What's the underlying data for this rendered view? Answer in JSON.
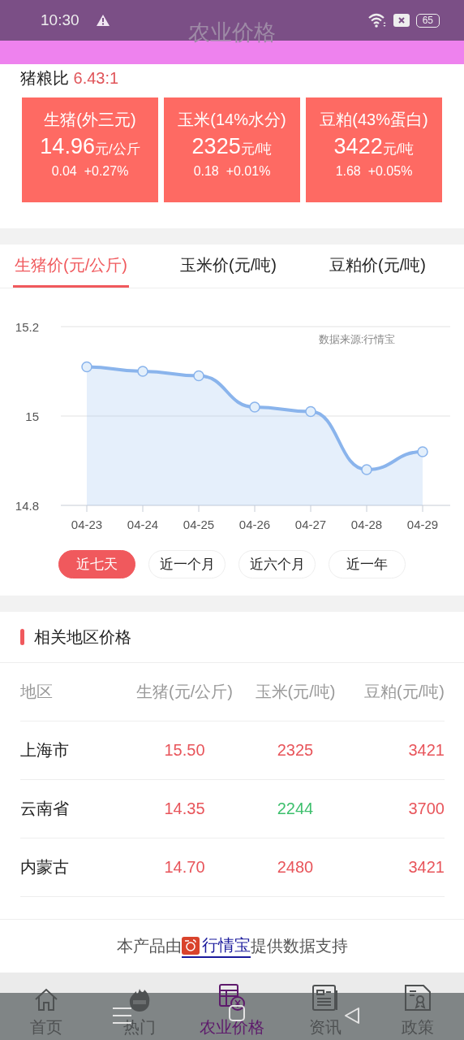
{
  "status_bar": {
    "time": "10:30",
    "battery": "65"
  },
  "header": {
    "title": "农业价格"
  },
  "ratio": {
    "label": "猪粮比",
    "value": "6.43:1"
  },
  "cards": [
    {
      "title": "生猪(外三元)",
      "price": "14.96",
      "unit": "元/公斤",
      "change": "0.04",
      "percent": "+0.27%"
    },
    {
      "title": "玉米(14%水分)",
      "price": "2325",
      "unit": "元/吨",
      "change": "0.18",
      "percent": "+0.01%"
    },
    {
      "title": "豆粕(43%蛋白)",
      "price": "3422",
      "unit": "元/吨",
      "change": "1.68",
      "percent": "+0.05%"
    }
  ],
  "tabs": [
    {
      "label": "生猪价(元/公斤)",
      "selected": true
    },
    {
      "label": "玉米价(元/吨)",
      "selected": false
    },
    {
      "label": "豆粕价(元/吨)",
      "selected": false
    }
  ],
  "chart_data": {
    "type": "area",
    "categories": [
      "04-23",
      "04-24",
      "04-25",
      "04-26",
      "04-27",
      "04-28",
      "04-29"
    ],
    "series": [
      {
        "color": "#8ab4ec",
        "values": [
          15.11,
          15.1,
          15.09,
          15.02,
          15.01,
          14.88,
          14.92
        ]
      }
    ],
    "ylim": [
      14.8,
      15.2
    ],
    "yticks": [
      14.8,
      15,
      15.2
    ],
    "annotations": [
      {
        "text": "数据来源:行情宝"
      }
    ]
  },
  "ranges": [
    {
      "label": "近七天",
      "selected": true
    },
    {
      "label": "近一个月",
      "selected": false
    },
    {
      "label": "近六个月",
      "selected": false
    },
    {
      "label": "近一年",
      "selected": false
    }
  ],
  "region_table": {
    "title": "相关地区价格",
    "columns": [
      "地区",
      "生猪(元/公斤)",
      "玉米(元/吨)",
      "豆粕(元/吨)"
    ],
    "rows": [
      {
        "cells": [
          {
            "value": "上海市",
            "color": "#222222"
          },
          {
            "value": "15.50",
            "color": "#e8555b"
          },
          {
            "value": "2325",
            "color": "#e8555b"
          },
          {
            "value": "3421",
            "color": "#e8555b"
          }
        ]
      },
      {
        "cells": [
          {
            "value": "云南省",
            "color": "#222222"
          },
          {
            "value": "14.35",
            "color": "#e8555b"
          },
          {
            "value": "2244",
            "color": "#3cbf6c"
          },
          {
            "value": "3700",
            "color": "#e8555b"
          }
        ]
      },
      {
        "cells": [
          {
            "value": "内蒙古",
            "color": "#222222"
          },
          {
            "value": "14.70",
            "color": "#e8555b"
          },
          {
            "value": "2480",
            "color": "#e8555b"
          },
          {
            "value": "3421",
            "color": "#e8555b"
          }
        ]
      }
    ]
  },
  "footer": {
    "before": "本产品由 ",
    "link": "行情宝",
    "after": "提供数据支持"
  },
  "nav": [
    {
      "label": "首页",
      "kind": "home",
      "selected": false
    },
    {
      "label": "热门",
      "kind": "hot",
      "selected": false
    },
    {
      "label": "农业价格",
      "kind": "price",
      "selected": true
    },
    {
      "label": "资讯",
      "kind": "news",
      "selected": false
    },
    {
      "label": "政策",
      "kind": "policy",
      "selected": false
    }
  ]
}
